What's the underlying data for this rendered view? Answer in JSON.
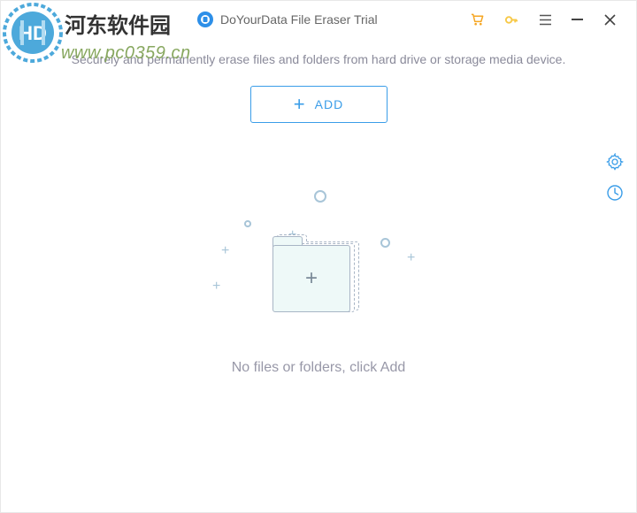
{
  "watermark": {
    "site_name": "河东软件园",
    "url": "www.pc0359.cn"
  },
  "app": {
    "title": "DoYourData File Eraser Trial",
    "subtitle": "Securely and permanently erase files and folders from hard drive or storage media device."
  },
  "actions": {
    "add_label": "ADD"
  },
  "empty_state": {
    "message": "No files or folders, click Add"
  },
  "colors": {
    "primary": "#3a9de8",
    "accent_orange": "#f5a623",
    "accent_yellow": "#f7c948",
    "text_muted": "#8a8a9a"
  }
}
